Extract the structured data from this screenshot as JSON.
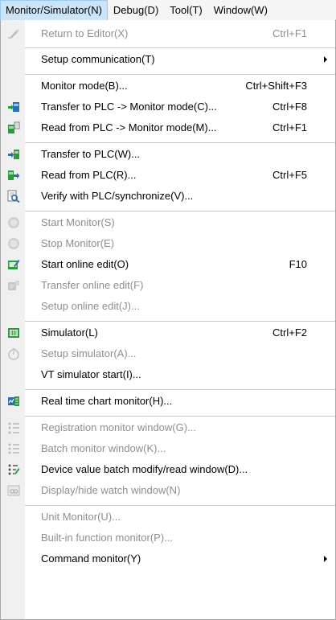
{
  "menubar": {
    "items": [
      {
        "label": "Monitor/Simulator(N)"
      },
      {
        "label": "Debug(D)"
      },
      {
        "label": "Tool(T)"
      },
      {
        "label": "Window(W)"
      }
    ]
  },
  "menu": {
    "items": [
      {
        "label": "Return to Editor(X)",
        "shortcut": "Ctrl+F1",
        "icon": "return-to-editor-icon",
        "enabled": false
      },
      {
        "label": "Setup communication(T)",
        "shortcut": "",
        "icon": "",
        "enabled": true,
        "submenu": true
      },
      {
        "label": "Monitor mode(B)...",
        "shortcut": "Ctrl+Shift+F3",
        "icon": "",
        "enabled": true
      },
      {
        "label": "Transfer to PLC -> Monitor mode(C)...",
        "shortcut": "Ctrl+F8",
        "icon": "transfer-monitor-icon",
        "enabled": true
      },
      {
        "label": "Read from PLC -> Monitor mode(M)...",
        "shortcut": "Ctrl+F1",
        "icon": "read-monitor-icon",
        "enabled": true
      },
      {
        "label": "Transfer to PLC(W)...",
        "shortcut": "",
        "icon": "transfer-to-plc-icon",
        "enabled": true
      },
      {
        "label": "Read from PLC(R)...",
        "shortcut": "Ctrl+F5",
        "icon": "read-from-plc-icon",
        "enabled": true
      },
      {
        "label": "Verify with PLC/synchronize(V)...",
        "shortcut": "",
        "icon": "verify-icon",
        "enabled": true
      },
      {
        "label": "Start Monitor(S)",
        "shortcut": "",
        "icon": "start-monitor-icon",
        "enabled": false
      },
      {
        "label": "Stop Monitor(E)",
        "shortcut": "",
        "icon": "stop-monitor-icon",
        "enabled": false
      },
      {
        "label": "Start online edit(O)",
        "shortcut": "F10",
        "icon": "online-edit-icon",
        "enabled": true
      },
      {
        "label": "Transfer online edit(F)",
        "shortcut": "",
        "icon": "transfer-online-edit-icon",
        "enabled": false
      },
      {
        "label": "Setup online edit(J)...",
        "shortcut": "",
        "icon": "",
        "enabled": false
      },
      {
        "label": "Simulator(L)",
        "shortcut": "Ctrl+F2",
        "icon": "simulator-icon",
        "enabled": true
      },
      {
        "label": "Setup simulator(A)...",
        "shortcut": "",
        "icon": "setup-simulator-icon",
        "enabled": false
      },
      {
        "label": "VT simulator start(I)...",
        "shortcut": "",
        "icon": "",
        "enabled": true
      },
      {
        "label": "Real time chart monitor(H)...",
        "shortcut": "",
        "icon": "realtime-chart-icon",
        "enabled": true
      },
      {
        "label": "Registration monitor window(G)...",
        "shortcut": "",
        "icon": "registration-monitor-icon",
        "enabled": false
      },
      {
        "label": "Batch monitor window(K)...",
        "shortcut": "",
        "icon": "batch-monitor-icon",
        "enabled": false
      },
      {
        "label": "Device value batch modify/read window(D)...",
        "shortcut": "",
        "icon": "device-value-icon",
        "enabled": true
      },
      {
        "label": "Display/hide watch window(N)",
        "shortcut": "",
        "icon": "watch-window-icon",
        "enabled": false
      },
      {
        "label": "Unit Monitor(U)...",
        "shortcut": "",
        "icon": "",
        "enabled": false
      },
      {
        "label": "Built-in function monitor(P)...",
        "shortcut": "",
        "icon": "",
        "enabled": false
      },
      {
        "label": "Command monitor(Y)",
        "shortcut": "",
        "icon": "",
        "enabled": true,
        "submenu": true
      }
    ]
  }
}
